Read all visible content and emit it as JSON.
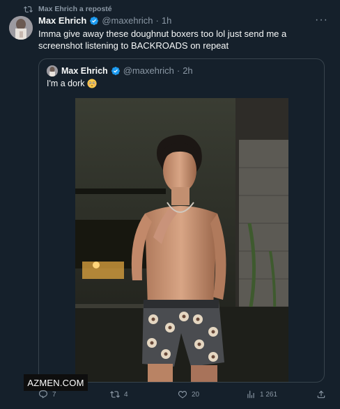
{
  "repost": {
    "label": "Max Ehrich a reposté",
    "icon": "repost-icon"
  },
  "tweet": {
    "author": "Max Ehrich",
    "handle": "@maxehrich",
    "time_sep": "·",
    "time": "1h",
    "text": "Imma give away these doughnut boxers too lol just send me a screenshot listening to BACKROADS on repeat",
    "more_label": "···"
  },
  "quote": {
    "author": "Max Ehrich",
    "handle": "@maxehrich",
    "time_sep": "·",
    "time": "2h",
    "text": "I'm a dork",
    "emoji": "flushed-face-icon"
  },
  "actions": {
    "replies": "7",
    "reposts": "4",
    "likes": "20",
    "views": "1 261"
  },
  "watermark": "AZMEN.COM",
  "colors": {
    "background": "#15202b",
    "text": "#f7f9f9",
    "muted": "#8b98a5",
    "verified": "#1d9bf0",
    "border": "#38444d"
  }
}
